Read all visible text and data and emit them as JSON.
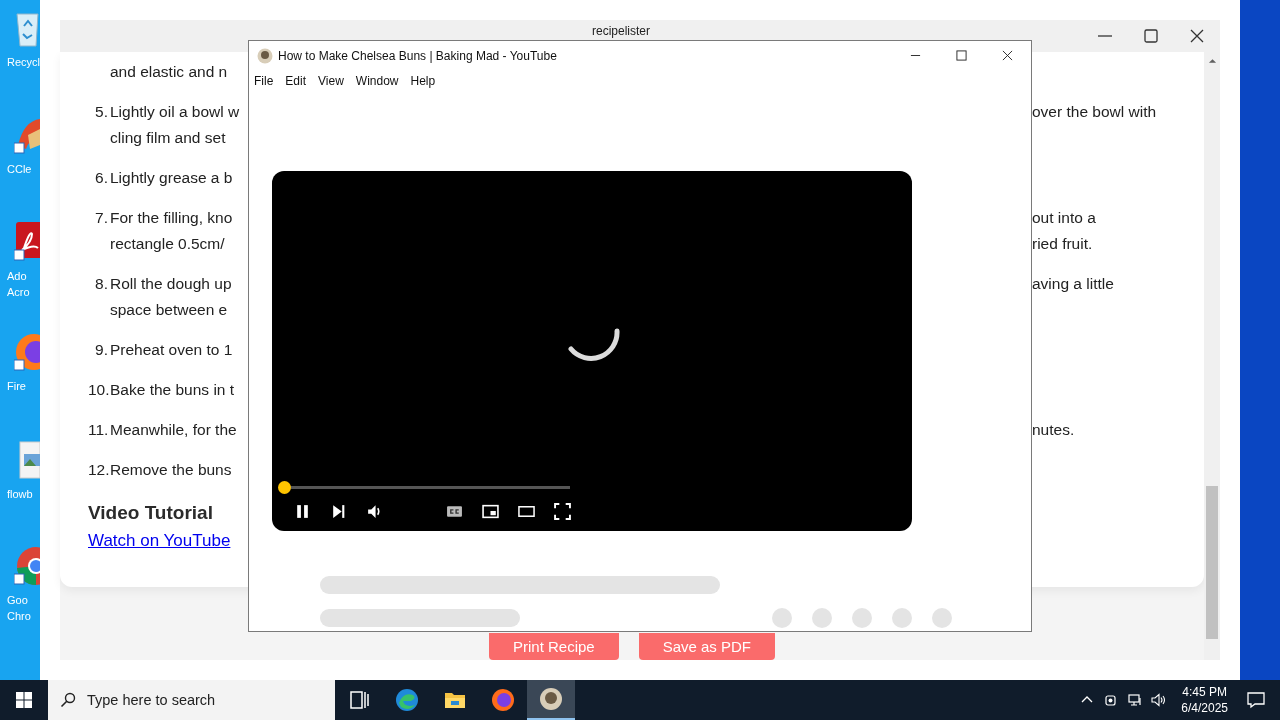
{
  "desktop": {
    "icons": [
      {
        "kind": "recycle-bin",
        "lines": [
          "Recycl"
        ]
      },
      {
        "kind": "cleaner",
        "lines": [
          "CCle"
        ]
      },
      {
        "kind": "pdf",
        "lines": [
          "Ado",
          "Acro"
        ]
      },
      {
        "kind": "firefox",
        "lines": [
          "Fire"
        ]
      },
      {
        "kind": "image-file",
        "lines": [
          "flowb"
        ]
      },
      {
        "kind": "chrome",
        "lines": [
          "Goo",
          "Chro"
        ]
      }
    ]
  },
  "main_window": {
    "title": "recipelister",
    "first_line": "and elastic and n",
    "steps": [
      {
        "number": "5.",
        "lines": [
          {
            "left": "Lightly oil a bowl w",
            "right": "over the bowl with"
          },
          {
            "left": "cling film and set"
          }
        ]
      },
      {
        "number": "6.",
        "lines": [
          {
            "left": "Lightly grease a b"
          }
        ]
      },
      {
        "number": "7.",
        "lines": [
          {
            "left": "For the filling, kno",
            "right": "out into a"
          },
          {
            "left": "rectangle 0.5cm/",
            "right": "ried fruit."
          }
        ]
      },
      {
        "number": "8.",
        "lines": [
          {
            "left": "Roll the dough up",
            "right": "aving a little"
          },
          {
            "left": "space between e"
          }
        ]
      },
      {
        "number": "9.",
        "lines": [
          {
            "left": "Preheat oven to 1"
          }
        ]
      },
      {
        "number": "10.",
        "lines": [
          {
            "left": "Bake the buns in t"
          }
        ]
      },
      {
        "number": "11.",
        "lines": [
          {
            "left": "Meanwhile, for the",
            "right": "nutes."
          }
        ]
      },
      {
        "number": "12.",
        "lines": [
          {
            "left": "Remove the buns"
          }
        ]
      }
    ],
    "heading": "Video Tutorial",
    "link": "Watch on YouTube",
    "buttons": [
      "Print Recipe",
      "Save as PDF"
    ]
  },
  "video_window": {
    "title": "How to Make Chelsea Buns | Baking Mad - YouTube",
    "menu": [
      "File",
      "Edit",
      "View",
      "Window",
      "Help"
    ],
    "player": {
      "level": 0
    }
  },
  "taskbar": {
    "search_placeholder": "Type here to search",
    "apps": [
      {
        "kind": "task-view",
        "selected": false
      },
      {
        "kind": "edge",
        "selected": false
      },
      {
        "kind": "folder",
        "selected": false
      },
      {
        "kind": "firefox",
        "selected": false
      },
      {
        "kind": "app",
        "selected": true
      }
    ],
    "time": "4:45 PM",
    "date": "6/4/2025"
  }
}
